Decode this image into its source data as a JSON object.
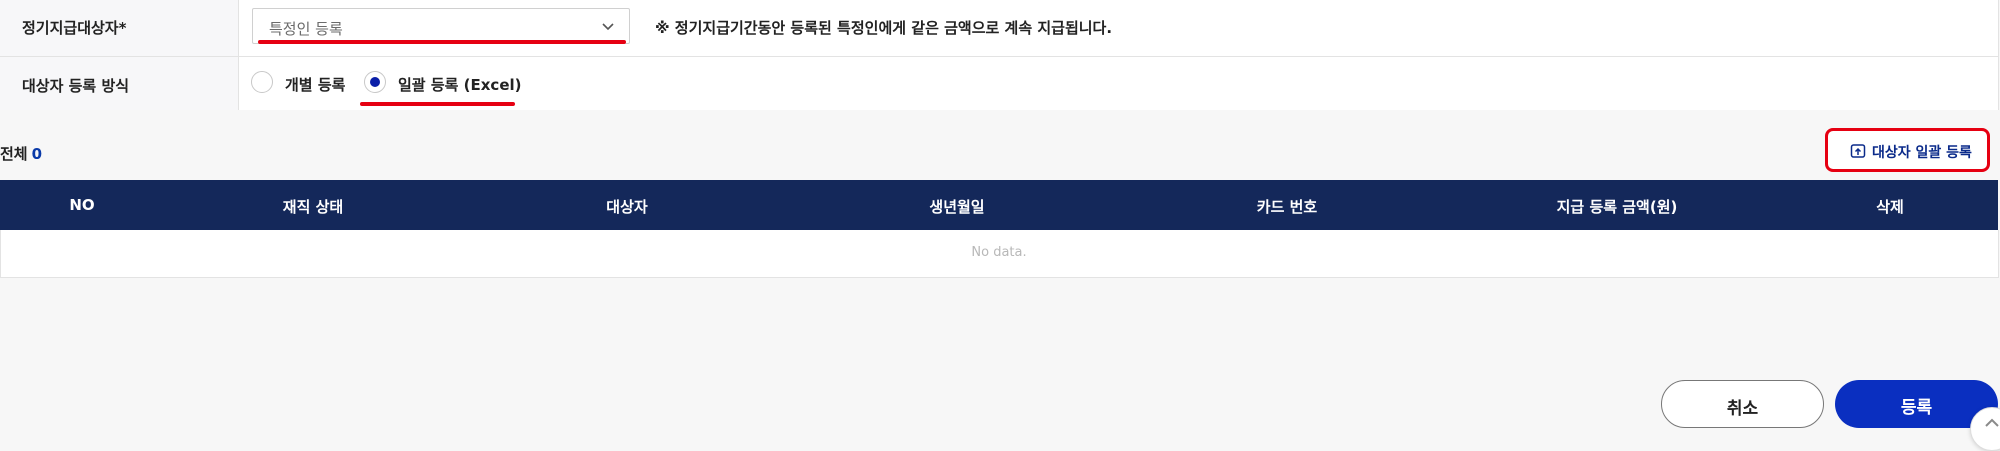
{
  "form": {
    "target_label": "정기지급대상자*",
    "target_select_value": "특정인 등록",
    "notice": "※ 정기지급기간동안 등록된 특정인에게 같은 금액으로 계속 지급됩니다.",
    "method_label": "대상자 등록 방식",
    "radio_individual": "개별 등록",
    "radio_bulk": "일괄 등록 (Excel)",
    "selected_method": "bulk"
  },
  "summary": {
    "total_label": "전체",
    "total_count": "0"
  },
  "actions": {
    "bulk_register": "대상자 일괄 등록"
  },
  "table": {
    "columns": [
      "NO",
      "재직 상태",
      "대상자",
      "생년월일",
      "카드 번호",
      "지급 등록 금액(원)",
      "삭제"
    ],
    "empty_text": "No data."
  },
  "footer": {
    "cancel": "취소",
    "submit": "등록"
  },
  "colors": {
    "header_bg": "#14285a",
    "primary": "#0a2fc0",
    "highlight": "#e60012"
  },
  "icons": {
    "select_chevron": "chevron-down-icon",
    "bulk_register": "upload-icon",
    "scroll_top": "chevron-up-icon"
  }
}
